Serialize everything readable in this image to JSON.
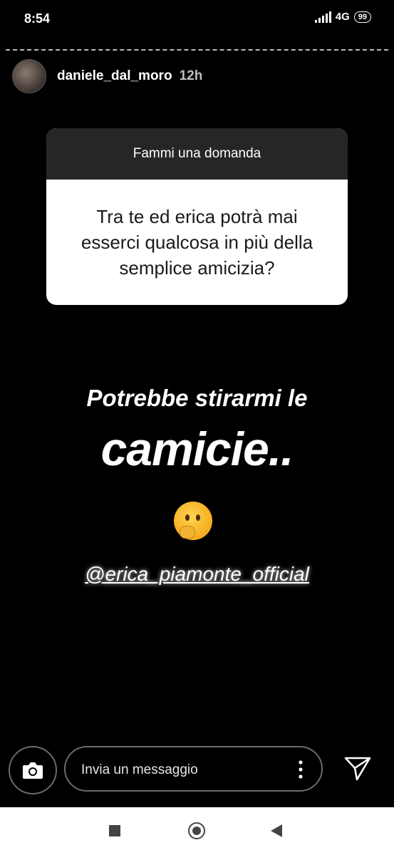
{
  "status_bar": {
    "time": "8:54",
    "network": "4G",
    "battery": "99"
  },
  "story_header": {
    "username": "daniele_dal_moro",
    "time_ago": "12h"
  },
  "question_card": {
    "header": "Fammi una domanda",
    "question_lines": [
      "Tra te ed erica potrà mai",
      "esserci qualcosa in più della",
      "semplice amicizia?"
    ]
  },
  "story_text": {
    "line1": "Potrebbe stirarmi le",
    "line2": "camicie..",
    "mention": "@erica_piamonte_official"
  },
  "emoji": "thinking-face",
  "reply_bar": {
    "placeholder": "Invia un messaggio"
  },
  "icons": {
    "camera": "camera-icon",
    "more": "more-vertical-icon",
    "send": "send-icon"
  },
  "colors": {
    "background": "#000000",
    "card_header": "#262626",
    "card_body": "#ffffff",
    "navbar": "#ffffff"
  }
}
